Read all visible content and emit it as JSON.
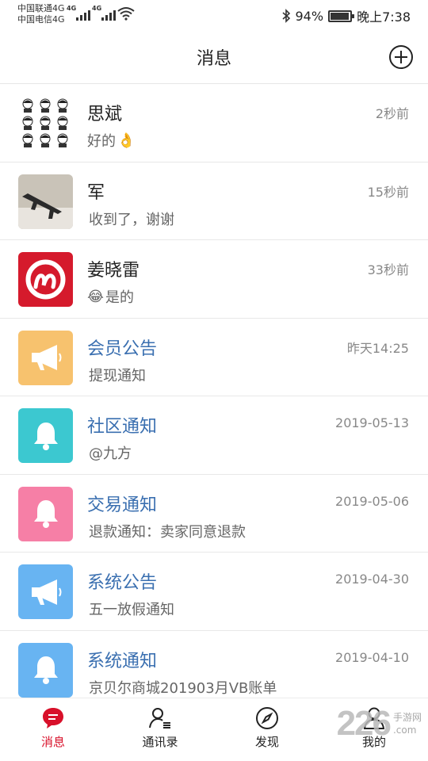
{
  "status_bar": {
    "carrier1": "中国联通4G",
    "carrier2": "中国电信4G",
    "net1": "4G",
    "net2": "4G",
    "battery": "94%",
    "battery_level": 0.94,
    "time": "晚上7:38",
    "icons": [
      "bluetooth-icon",
      "wifi-icon",
      "battery-icon",
      "signal-icon"
    ]
  },
  "header": {
    "title": "消息",
    "add_icon": "plus-circle-icon"
  },
  "conversations": [
    {
      "name": "思斌",
      "time": "2秒前",
      "message": "好的",
      "emoji": "👌",
      "avatar": "meme-grid",
      "system": false
    },
    {
      "name": "军",
      "time": "15秒前",
      "message": "收到了，谢谢",
      "emoji": "",
      "avatar": "photo-rifle",
      "system": false
    },
    {
      "name": "姜晓雷",
      "time": "33秒前",
      "message": "是的",
      "emoji": "😂",
      "avatar": "red-logo",
      "system": false
    },
    {
      "name": "会员公告",
      "time": "昨天14:25",
      "message": "提现通知",
      "emoji": "",
      "avatar": "megaphone",
      "color": "#f7c26e",
      "system": true
    },
    {
      "name": "社区通知",
      "time": "2019-05-13",
      "message": "@九方",
      "emoji": "",
      "avatar": "bell",
      "color": "#3cc8d0",
      "system": true
    },
    {
      "name": "交易通知",
      "time": "2019-05-06",
      "message": "退款通知：卖家同意退款",
      "emoji": "",
      "avatar": "bell",
      "color": "#f67fa6",
      "system": true
    },
    {
      "name": "系统公告",
      "time": "2019-04-30",
      "message": "五一放假通知",
      "emoji": "",
      "avatar": "megaphone",
      "color": "#68b4f2",
      "system": true
    },
    {
      "name": "系统通知",
      "time": "2019-04-10",
      "message": "京贝尔商城201903月VB账单",
      "emoji": "",
      "avatar": "bell",
      "color": "#68b4f2",
      "system": true
    }
  ],
  "nav": {
    "items": [
      {
        "label": "消息",
        "icon": "chat-bubble-icon",
        "active": true
      },
      {
        "label": "通讯录",
        "icon": "contacts-icon",
        "active": false
      },
      {
        "label": "发现",
        "icon": "compass-icon",
        "active": false
      },
      {
        "label": "我的",
        "icon": "person-icon",
        "active": false
      }
    ],
    "accent": "#d8102a"
  },
  "watermark": {
    "number": "226",
    "line1": "手游网",
    "line2": ".com"
  }
}
